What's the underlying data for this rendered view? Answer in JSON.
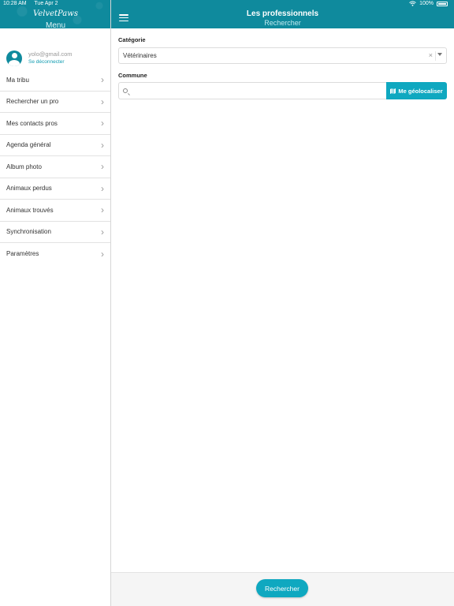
{
  "status_bar": {
    "time": "10:28 AM",
    "date": "Tue Apr 2",
    "battery": "100%"
  },
  "sidebar": {
    "logo": "VelvetPaws",
    "title": "Menu",
    "user": {
      "email": "yolo@gmail.com",
      "logout_label": "Se déconnecter"
    },
    "items": [
      {
        "label": "Ma tribu"
      },
      {
        "label": "Rechercher un pro"
      },
      {
        "label": "Mes contacts pros"
      },
      {
        "label": "Agenda général"
      },
      {
        "label": "Album photo"
      },
      {
        "label": "Animaux perdus"
      },
      {
        "label": "Animaux trouvés"
      },
      {
        "label": "Synchronisation"
      },
      {
        "label": "Paramètres"
      }
    ]
  },
  "header": {
    "title": "Les professionnels",
    "subtitle": "Rechercher"
  },
  "form": {
    "category_label": "Catégorie",
    "category_value": "Vétérinaires",
    "commune_label": "Commune",
    "commune_placeholder": "",
    "geo_button_label": "Me géolocaliser"
  },
  "footer": {
    "submit_label": "Rechercher"
  },
  "colors": {
    "accent": "#0f8a9d",
    "button": "#0fa8c0"
  }
}
